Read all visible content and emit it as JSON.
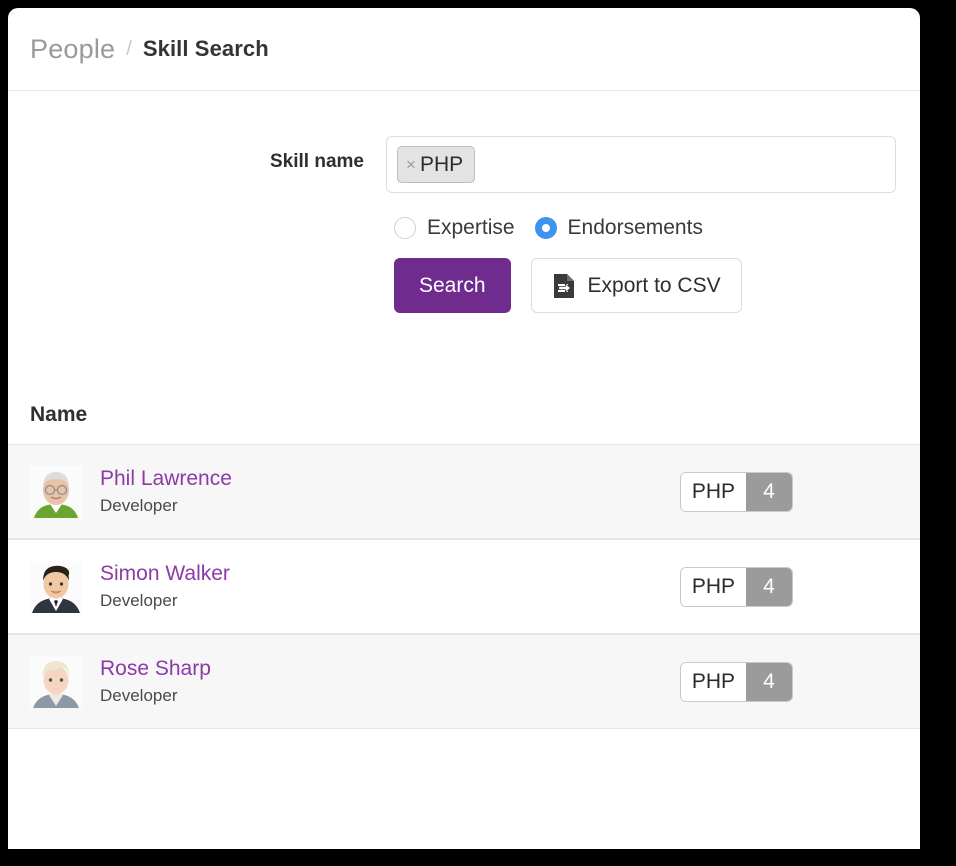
{
  "breadcrumb": {
    "root": "People",
    "separator": "/",
    "current": "Skill Search"
  },
  "form": {
    "skill_label": "Skill name",
    "tag": {
      "label": "PHP",
      "remove_icon": "×"
    },
    "input_placeholder": "",
    "radios": [
      {
        "label": "Expertise",
        "selected": false
      },
      {
        "label": "Endorsements",
        "selected": true
      }
    ],
    "search_button": "Search",
    "export_button": "Export to CSV",
    "export_icon": "export-csv-icon"
  },
  "results": {
    "column_header": "Name",
    "rows": [
      {
        "name": "Phil Lawrence",
        "role": "Developer",
        "skill": "PHP",
        "count": "4",
        "avatar": "older-man-green-sweater"
      },
      {
        "name": "Simon Walker",
        "role": "Developer",
        "skill": "PHP",
        "count": "4",
        "avatar": "young-man-dark-suit"
      },
      {
        "name": "Rose Sharp",
        "role": "Developer",
        "skill": "PHP",
        "count": "4",
        "avatar": "blonde-woman"
      }
    ]
  },
  "colors": {
    "brand_purple": "#702b8f",
    "link_purple": "#8c3aa8",
    "radio_blue": "#3d93f0",
    "badge_gray": "#9b9b9b",
    "row_alt": "#f7f7f7"
  }
}
